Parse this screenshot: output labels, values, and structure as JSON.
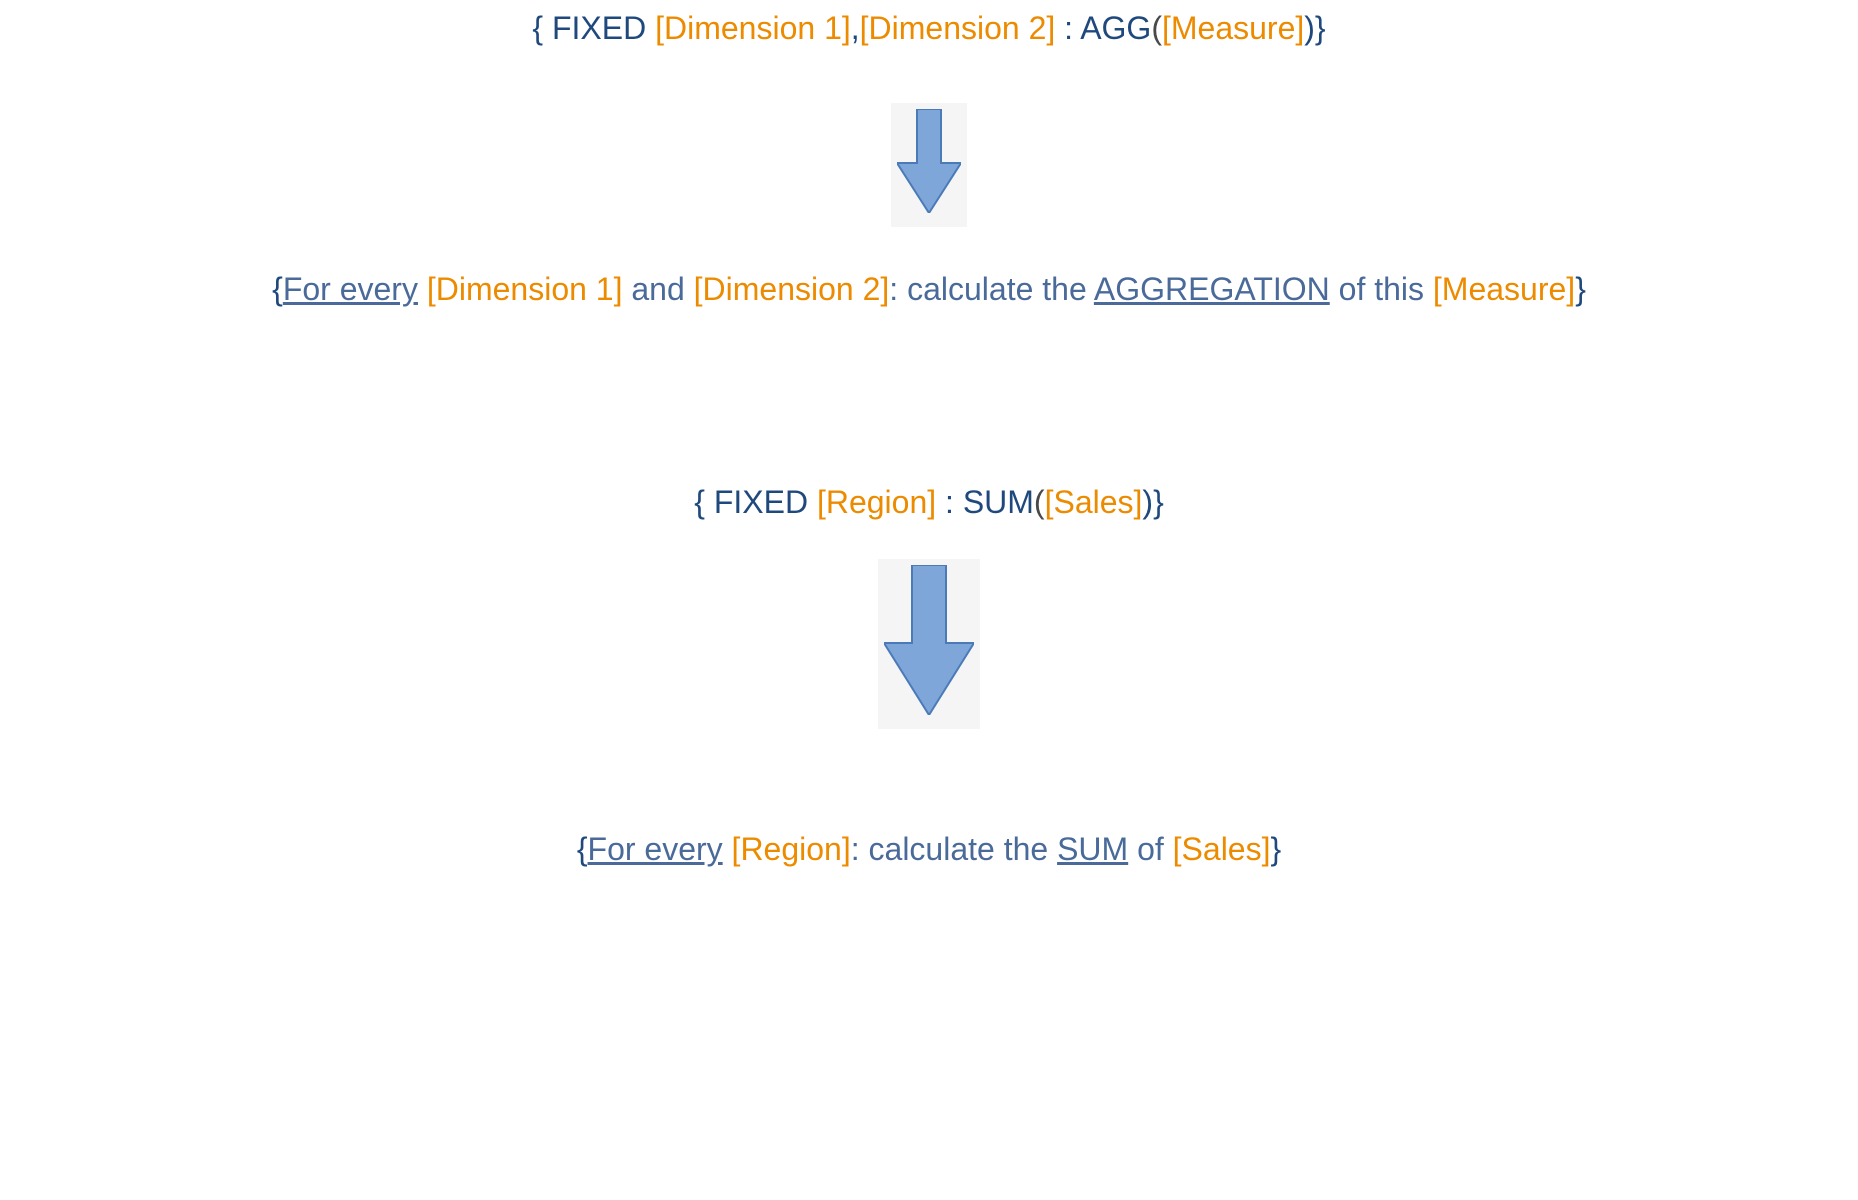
{
  "line1": {
    "open": "{ ",
    "fixed": "FIXED ",
    "dim1": "[Dimension 1]",
    "sep": ",",
    "dim2": "[Dimension 2]",
    "colon": " : ",
    "agg": "AGG",
    "paren_open": "(",
    "measure": "[Measure]",
    "paren_close": ")",
    "close": "}"
  },
  "line2": {
    "open": "{",
    "for_every": "For every",
    "space1": " ",
    "dim1": "[Dimension 1]",
    "and": " and ",
    "dim2": "[Dimension 2]",
    "calc": ": calculate the ",
    "agg_word": "AGGREGATION",
    "of_this": " of this ",
    "measure": "[Measure]",
    "close": "}"
  },
  "line3": {
    "open": "{ ",
    "fixed": "FIXED ",
    "region": "[Region]",
    "colon": " : ",
    "sum": "SUM",
    "paren_open": "(",
    "sales": "[Sales]",
    "paren_close": ")",
    "close": "}"
  },
  "line4": {
    "open": "{",
    "for_every": "For every",
    "space1": " ",
    "region": "[Region]",
    "calc": ": calculate the ",
    "sum_word": "SUM",
    "of": " of ",
    "sales": "[Sales]",
    "close": "}"
  }
}
